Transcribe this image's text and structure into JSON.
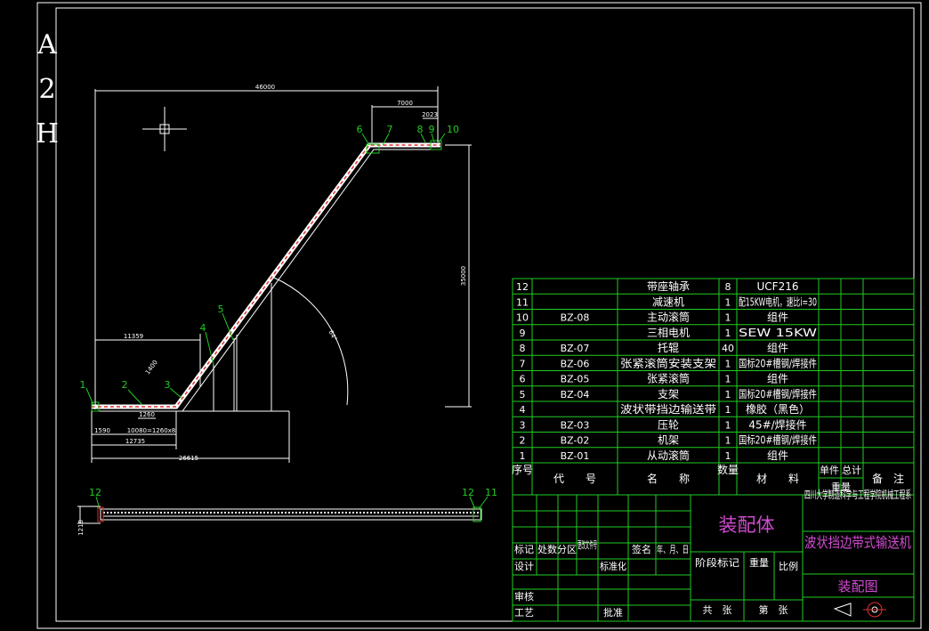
{
  "sheet": {
    "side_mark": [
      "A",
      "2",
      "H"
    ]
  },
  "dimensions": {
    "total_length": "46000",
    "top_section": "7000",
    "top_end": "2023",
    "height": "35000",
    "angle": "64°",
    "lower_section": "11359",
    "slope_seg": "1400",
    "pitch": "1260",
    "bottom_a": "1590",
    "bottom_b": "10080=1260x8",
    "bottom_c": "12735",
    "bottom_total": "26615",
    "plan_width": "1218"
  },
  "balloons": [
    "1",
    "2",
    "3",
    "4",
    "5",
    "6",
    "7",
    "8",
    "9",
    "10"
  ],
  "plan_balloons": [
    "12",
    "12",
    "11"
  ],
  "parts_table": {
    "rows": [
      {
        "no": "12",
        "code": "",
        "name": "带座轴承",
        "qty": "8",
        "material": "UCF216",
        "note": ""
      },
      {
        "no": "11",
        "code": "",
        "name": "减速机",
        "qty": "1",
        "material": "配15KW电机，速比i=30",
        "note": ""
      },
      {
        "no": "10",
        "code": "BZ-08",
        "name": "主动滚筒",
        "qty": "1",
        "material": "组件",
        "note": ""
      },
      {
        "no": "9",
        "code": "",
        "name": "三相电机",
        "qty": "1",
        "material": "SEW 15KW",
        "note": ""
      },
      {
        "no": "8",
        "code": "BZ-07",
        "name": "托辊",
        "qty": "40",
        "material": "组件",
        "note": ""
      },
      {
        "no": "7",
        "code": "BZ-06",
        "name": "张紧滚筒安装支架",
        "qty": "1",
        "material": "国标20#槽钢/焊接件",
        "note": ""
      },
      {
        "no": "6",
        "code": "BZ-05",
        "name": "张紧滚筒",
        "qty": "1",
        "material": "组件",
        "note": ""
      },
      {
        "no": "5",
        "code": "BZ-04",
        "name": "支架",
        "qty": "1",
        "material": "国标20#槽钢/焊接件",
        "note": ""
      },
      {
        "no": "4",
        "code": "",
        "name": "波状带挡边输送带",
        "qty": "1",
        "material": "橡胶（黑色）",
        "note": ""
      },
      {
        "no": "3",
        "code": "BZ-03",
        "name": "压轮",
        "qty": "1",
        "material": "45#/焊接件",
        "note": ""
      },
      {
        "no": "2",
        "code": "BZ-02",
        "name": "机架",
        "qty": "1",
        "material": "国标20#槽钢/焊接件",
        "note": ""
      },
      {
        "no": "1",
        "code": "BZ-01",
        "name": "从动滚筒",
        "qty": "1",
        "material": "组件",
        "note": ""
      }
    ],
    "header": {
      "no": "序号",
      "code": "代　　号",
      "name": "名　　称",
      "qty": "数量",
      "material": "材　　料",
      "unit_weight": "单件",
      "total_weight": "总计",
      "weight": "重量",
      "note": "备　注"
    }
  },
  "title_block": {
    "assembly": "装配体",
    "institution": "四川大学制造科学与工程学院机械工程系",
    "title": "波状挡边带式输送机",
    "drawing_name": "装配图",
    "marks": "标记",
    "count": "处数",
    "zone": "分区",
    "change_doc": "更改文件号",
    "sign": "签名",
    "date": "年、月、日",
    "design": "设计",
    "std": "标准化",
    "stage": "阶段标记",
    "weight": "重量",
    "scale": "比例",
    "review": "审核",
    "process": "工艺",
    "approve": "批准",
    "total_sheets": "共　张",
    "sheet_no": "第　张"
  }
}
